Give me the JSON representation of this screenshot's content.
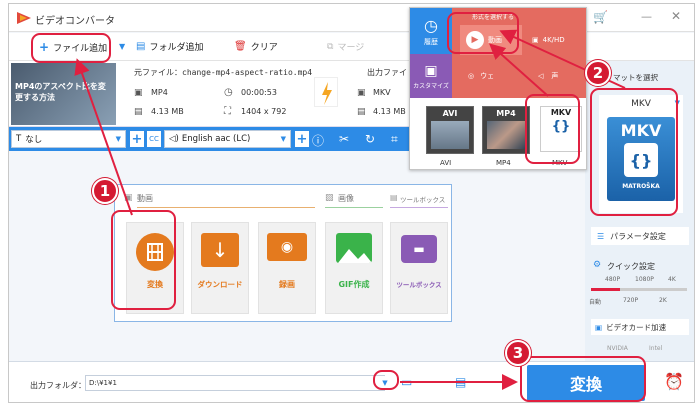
{
  "title_bar": {
    "app_title": "ビデオコンバータ"
  },
  "toolbar": {
    "add_file": "ファイル追加",
    "add_folder": "フォルダ追加",
    "clear": "クリア",
    "merge": "マージ"
  },
  "file": {
    "thumb_caption": "MP4のアスペクト比を変更する方法",
    "source_label": "元ファイル：change-mp4-aspect-ratio.mp4",
    "format": "MP4",
    "duration": "00:00:53",
    "size": "4.13 MB",
    "resolution": "1404 x 792",
    "output_label": "出力ファイ",
    "output_format": "MKV",
    "output_size": "4.13 MB"
  },
  "edit_bar": {
    "subtitle": "なし",
    "audio": "English aac (LC)"
  },
  "categories": {
    "video_header": "動画",
    "image_header": "画像",
    "toolbox_header": "ツールボックス"
  },
  "tools": [
    {
      "label": "変換",
      "color": "#e47a1e"
    },
    {
      "label": "ダウンロード",
      "color": "#e47a1e"
    },
    {
      "label": "録画",
      "color": "#e47a1e"
    },
    {
      "label": "GIF作成",
      "color": "#3ab34a"
    },
    {
      "label": "ツールボックス",
      "color": "#8a5ab5"
    }
  ],
  "format_popup": {
    "header": "形式を選択する",
    "history": "履歴",
    "customize": "カスタマイズ",
    "video_tab": "動画",
    "hd_tab": "4K/HD",
    "web_tab": "ウェ",
    "audio_tab": "声",
    "formats": [
      "AVI",
      "MP4",
      "MKV"
    ]
  },
  "right_panel": {
    "select_format": "マットを選択",
    "format": "MKV",
    "logo_text": "MKV",
    "logo_brand": "MATROŠKA",
    "params": "パラメータ設定",
    "quick": "クイック設定",
    "res_top": [
      "480P",
      "1080P",
      "4K"
    ],
    "res_bottom": [
      "自動",
      "720P",
      "2K"
    ],
    "gpu": "ビデオカード加速",
    "gpu_opts": [
      "NVIDIA",
      "Intel"
    ]
  },
  "bottom": {
    "output_folder_label": "出力フォルダ：",
    "output_path": "D:\\¥1¥1",
    "convert": "変換"
  },
  "badges": [
    "1",
    "2",
    "3"
  ],
  "accent": "#2d8be6",
  "highlight": "#e02040"
}
